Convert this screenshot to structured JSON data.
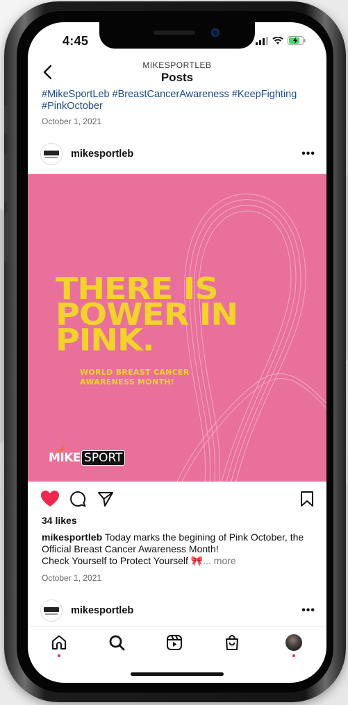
{
  "status_bar": {
    "time": "4:45"
  },
  "nav": {
    "account": "MIKESPORTLEB",
    "title": "Posts"
  },
  "previous_post": {
    "hashtags": "#MikeSportLeb #BreastCancerAwareness #KeepFighting #PinkOctober",
    "date": "October 1, 2021"
  },
  "post": {
    "username": "mikesportleb",
    "more_options": "•••",
    "image": {
      "headline": [
        "THERE IS",
        "POWER IN",
        "PINK."
      ],
      "subline": [
        "WORLD BREAST CANCER",
        "AWARENESS MONTH!"
      ],
      "brand_bold": "MIKE",
      "brand_light": "SPORT",
      "background_color": "#e8709a",
      "text_color": "#f2d22b"
    },
    "likes": "34 likes",
    "caption_user": "mikesportleb",
    "caption_text": "Today marks the begining of Pink October, the Official Breast Cancer Awareness Month!",
    "caption_line2": "Check Yourself to Protect Yourself 🎀",
    "caption_more": "... more",
    "date": "October 1, 2021",
    "liked": true,
    "like_color": "#ed2a4d"
  },
  "next_post": {
    "username": "mikesportleb",
    "more_options": "•••"
  },
  "tabbar": {
    "icons": [
      "home-icon",
      "search-icon",
      "reels-icon",
      "shop-icon",
      "profile-avatar"
    ]
  }
}
